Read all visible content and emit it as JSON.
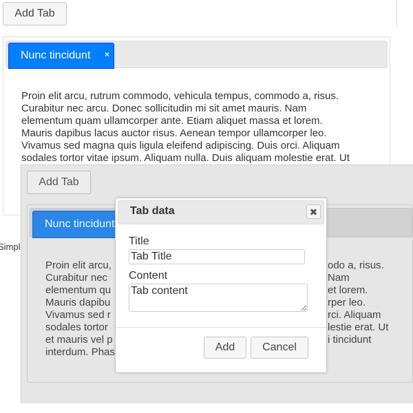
{
  "background_page": {
    "add_tab_label": "Add Tab",
    "active_tab": {
      "label": "Nunc tincidunt",
      "close_glyph": "×"
    },
    "paragraph_lines": [
      "Proin elit arcu, rutrum commodo, vehicula tempus, commodo a, risus.",
      "Curabitur nec arcu. Donec sollicitudin mi sit amet mauris. Nam",
      "elementum quam ullamcorper ante. Etiam aliquet massa et lorem.",
      "Mauris dapibus lacus auctor risus. Aenean tempor ullamcorper leo.",
      "Vivamus sed magna quis ligula eleifend adipiscing. Duis orci. Aliquam",
      "sodales tortor vitae ipsum. Aliquam nulla. Duis aliquam molestie erat. Ut"
    ],
    "footer_text": "Simpl"
  },
  "overlay_page": {
    "add_tab_label": "Add Tab",
    "active_tab": {
      "label": "Nunc tincidunt"
    },
    "paragraph_left_lines": [
      "Proin elit arcu,",
      "Curabitur nec",
      "elementum qu",
      "Mauris dapibu",
      "Vivamus sed r",
      "sodales tortor",
      "et mauris vel p",
      "interdum. Phas"
    ],
    "paragraph_right_lines": [
      "odo a, risus.",
      "Nam",
      "et lorem.",
      "rper leo.",
      "rci. Aliquam",
      "lestie erat. Ut",
      "i tincidunt",
      ""
    ]
  },
  "dialog": {
    "title": "Tab data",
    "close_glyph": "✖",
    "title_field": {
      "label": "Title",
      "value": "Tab Title"
    },
    "content_field": {
      "label": "Content",
      "value": "Tab content"
    },
    "add_button": "Add",
    "cancel_button": "Cancel"
  },
  "colors": {
    "active_tab": "#007fff",
    "overlay_bg": "#e6e6e6"
  }
}
